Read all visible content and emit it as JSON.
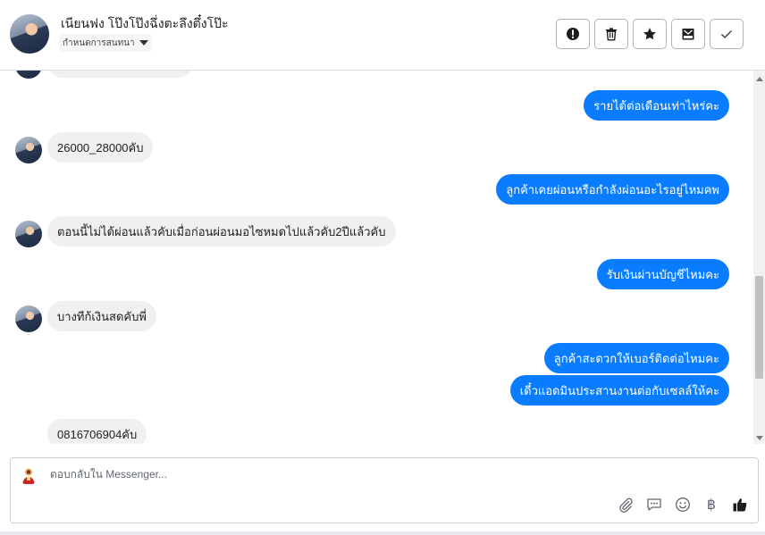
{
  "header": {
    "contact_name": "เนียนฟง โป๊งโป๊งฉึ่งตะลึงตึ๋งโป๊ะ",
    "conversation_status": "กำหนดการสนทนา",
    "actions": [
      "mark-spam",
      "delete",
      "star",
      "archive",
      "mark-done"
    ]
  },
  "thread": {
    "messages": [
      {
        "from": "customer",
        "text": ""
      },
      {
        "from": "page",
        "text": "รายได้ต่อเดือนเท่าไหร่คะ"
      },
      {
        "from": "customer",
        "text": "26000_28000คับ"
      },
      {
        "from": "page",
        "text": "ลูกค้าเคยผ่อนหรือกำลังผ่อนอะไรอยู่ไหมคพ"
      },
      {
        "from": "customer",
        "text": "ตอนนี้ไม่ได้ผ่อนแล้วคับเมื่อก่อนผ่อนมอไซหมดไปแล้วคับ2ปีแล้วคับ"
      },
      {
        "from": "page",
        "text": "รับเงินผ่านบัญชีไหมคะ"
      },
      {
        "from": "customer",
        "text": "บางทีก้เงินสดคับพี่"
      },
      {
        "from": "page",
        "text": "ลูกค้าสะดวกให้เบอร์ติดต่อไหมคะ"
      },
      {
        "from": "page",
        "text": "เดี๋วแอดมินประสานงานต่อกับเซลล์ให้คะ"
      },
      {
        "from": "customer",
        "text": "0816706904คับ"
      }
    ]
  },
  "composer": {
    "placeholder": "ตอบกลับใน Messenger...",
    "tools": [
      "attachment-icon",
      "saved-reply-icon",
      "emoji-icon",
      "baht-icon",
      "like-icon"
    ],
    "baht_symbol": "฿"
  },
  "colors": {
    "outgoing_bubble": "#0a7cff",
    "incoming_bubble": "#f0f0f0"
  }
}
